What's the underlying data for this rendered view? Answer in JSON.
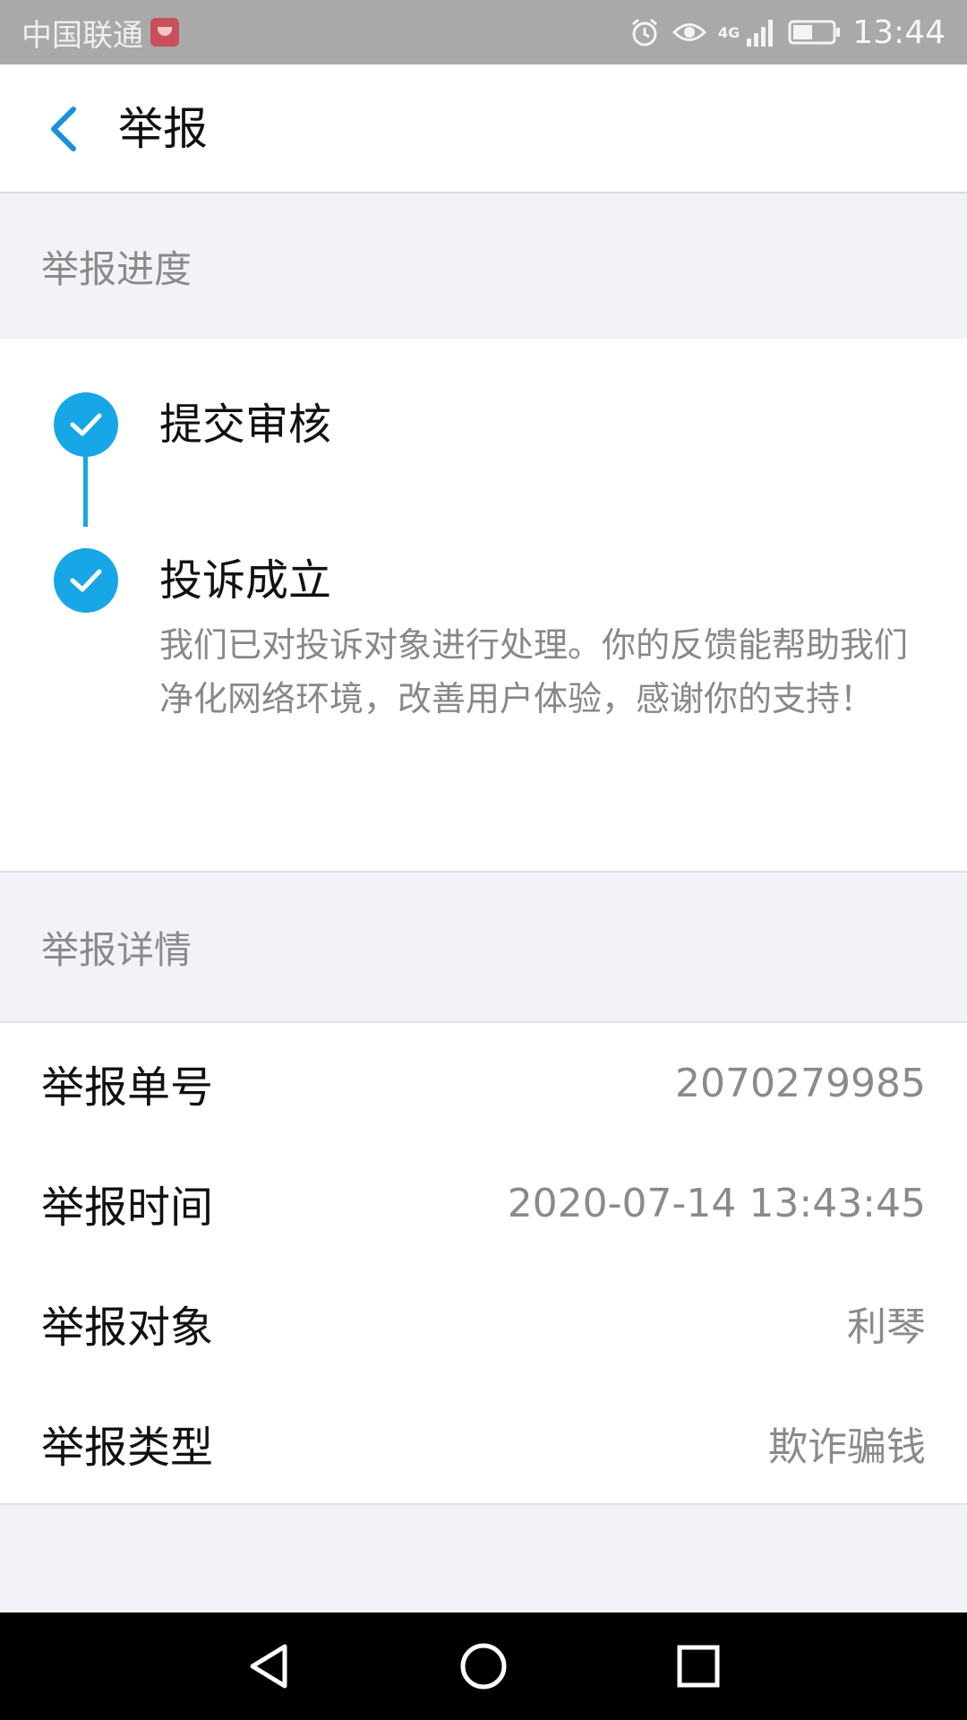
{
  "status_bar": {
    "carrier": "中国联通",
    "network": "4G",
    "time": "13:44",
    "battery_level": 0.5
  },
  "header": {
    "title": "举报"
  },
  "progress": {
    "section_title": "举报进度",
    "steps": [
      {
        "title": "提交审核",
        "description": ""
      },
      {
        "title": "投诉成立",
        "description": "我们已对投诉对象进行处理。你的反馈能帮助我们净化网络环境，改善用户体验，感谢你的支持！"
      }
    ]
  },
  "details": {
    "section_title": "举报详情",
    "rows": [
      {
        "label": "举报单号",
        "value": "2070279985"
      },
      {
        "label": "举报时间",
        "value": "2020-07-14 13:43:45"
      },
      {
        "label": "举报对象",
        "value": "利琴"
      },
      {
        "label": "举报类型",
        "value": "欺诈骗钱"
      }
    ]
  },
  "colors": {
    "accent": "#17a7e6",
    "back_arrow": "#1a8fe0",
    "status_bar_bg": "#a9a9a9",
    "section_bg": "#f2f3f8"
  },
  "icons": {
    "back": "chevron-left-icon",
    "step_done": "check-circle-icon",
    "nav_back": "triangle-back-icon",
    "nav_home": "circle-home-icon",
    "nav_recent": "square-recent-icon"
  }
}
